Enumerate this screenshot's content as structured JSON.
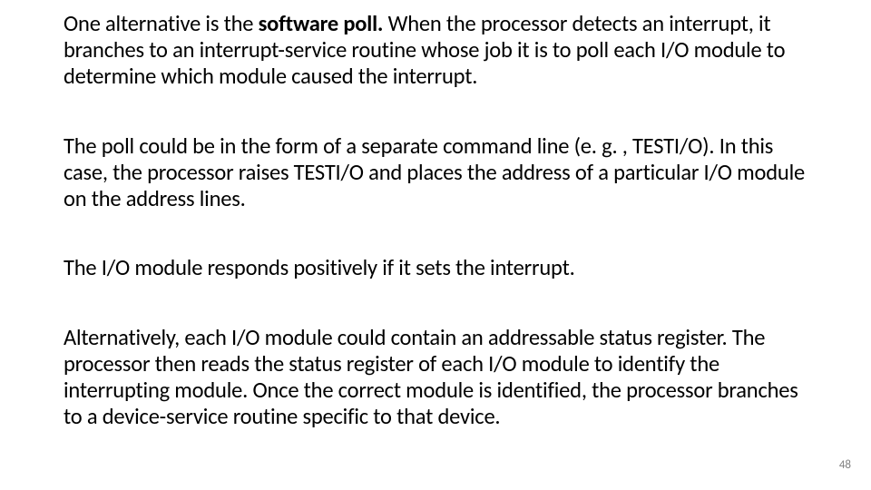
{
  "paragraphs": {
    "p1a": "One alternative is the ",
    "p1b": "software poll.",
    "p1c": " When the processor detects an interrupt, it branches to an interrupt-service routine whose job it is to poll each I/O module to determine which module caused the interrupt.",
    "p2": "The poll could be in the form of a separate command line (e. g. , TESTI/O). In this case, the processor raises TESTI/O and places the address of a particular I/O module on the address lines.",
    "p3": "The I/O  module responds positively if it sets the interrupt.",
    "p4": "Alternatively, each I/O module could contain an addressable status register. The processor then reads the status register of each I/O module to identify the interrupting module. Once the correct module is identified, the processor branches to a device-service routine specific to that device."
  },
  "page_number": "48"
}
